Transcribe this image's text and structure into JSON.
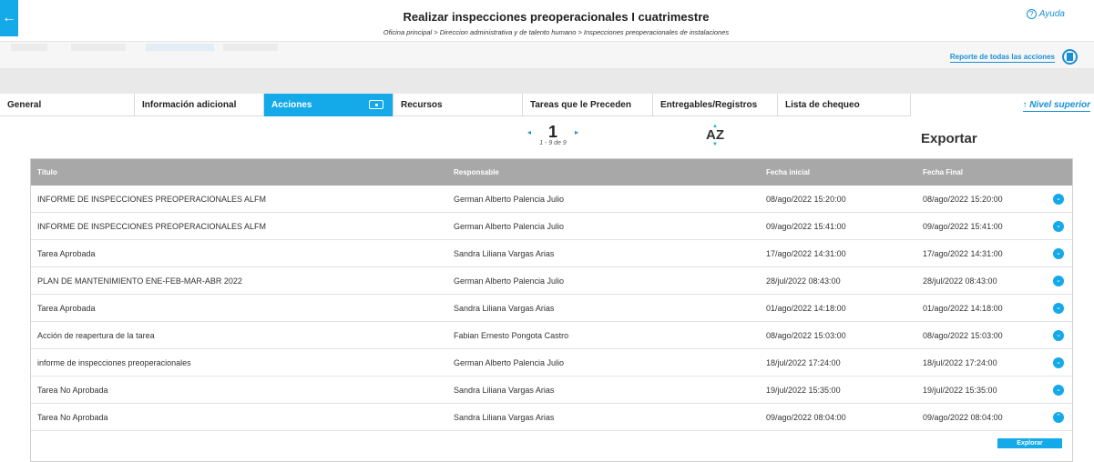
{
  "header": {
    "title": "Realizar inspecciones preoperacionales I cuatrimestre",
    "breadcrumb": "Oficina principal > Direccion administrativa y de talento humano > Inspecciones preoperacionales de instalaciones",
    "help_label": "Ayuda",
    "report_link": "Reporte de todas las acciones",
    "nivel_superior": "↑ Nivel superior"
  },
  "tabs": [
    {
      "label": "General"
    },
    {
      "label": "Información adicional"
    },
    {
      "label": "Acciones",
      "active": true
    },
    {
      "label": "Recursos"
    },
    {
      "label": "Tareas que le Preceden"
    },
    {
      "label": "Entregables/Registros"
    },
    {
      "label": "Lista de chequeo"
    }
  ],
  "pager": {
    "page": "1",
    "range": "1 - 9 de 9"
  },
  "sort_label": "AZ",
  "export_label": "Exportar",
  "table": {
    "columns": [
      "Título",
      "Responsable",
      "Fecha inicial",
      "Fecha Final"
    ],
    "rows": [
      [
        "INFORME DE INSPECCIONES PREOPERACIONALES ALFM",
        "German Alberto Palencia Julio",
        "08/ago/2022 15:20:00",
        "08/ago/2022 15:20:00"
      ],
      [
        "INFORME DE INSPECCIONES PREOPERACIONALES ALFM",
        "German Alberto Palencia Julio",
        "09/ago/2022 15:41:00",
        "09/ago/2022 15:41:00"
      ],
      [
        "Tarea Aprobada",
        "Sandra Liliana Vargas Arias",
        "17/ago/2022 14:31:00",
        "17/ago/2022 14:31:00"
      ],
      [
        "PLAN DE MANTENIMIENTO ENE-FEB-MAR-ABR 2022",
        "German Alberto Palencia Julio",
        "28/jul/2022 08:43:00",
        "28/jul/2022 08:43:00"
      ],
      [
        "Tarea Aprobada",
        "Sandra Liliana Vargas Arias",
        "01/ago/2022 14:18:00",
        "01/ago/2022 14:18:00"
      ],
      [
        "Acción de reapertura de la tarea",
        "Fabian Ernesto Pongota Castro",
        "08/ago/2022 15:03:00",
        "08/ago/2022 15:03:00"
      ],
      [
        "informe de inspecciones preoperacionales",
        "German Alberto Palencia Julio",
        "18/jul/2022 17:24:00",
        "18/jul/2022 17:24:00"
      ],
      [
        "Tarea No Aprobada",
        "Sandra Liliana Vargas Arias",
        "19/jul/2022 15:35:00",
        "19/jul/2022 15:35:00"
      ],
      [
        "Tarea No Aprobada",
        "Sandra Liliana Vargas Arias",
        "09/ago/2022 08:04:00",
        "09/ago/2022 08:04:00"
      ]
    ]
  },
  "explore_label": "Explorar",
  "colors": {
    "accent": "#14a9e8",
    "link": "#1a8fd6",
    "table_header": "#a8a8a8"
  }
}
